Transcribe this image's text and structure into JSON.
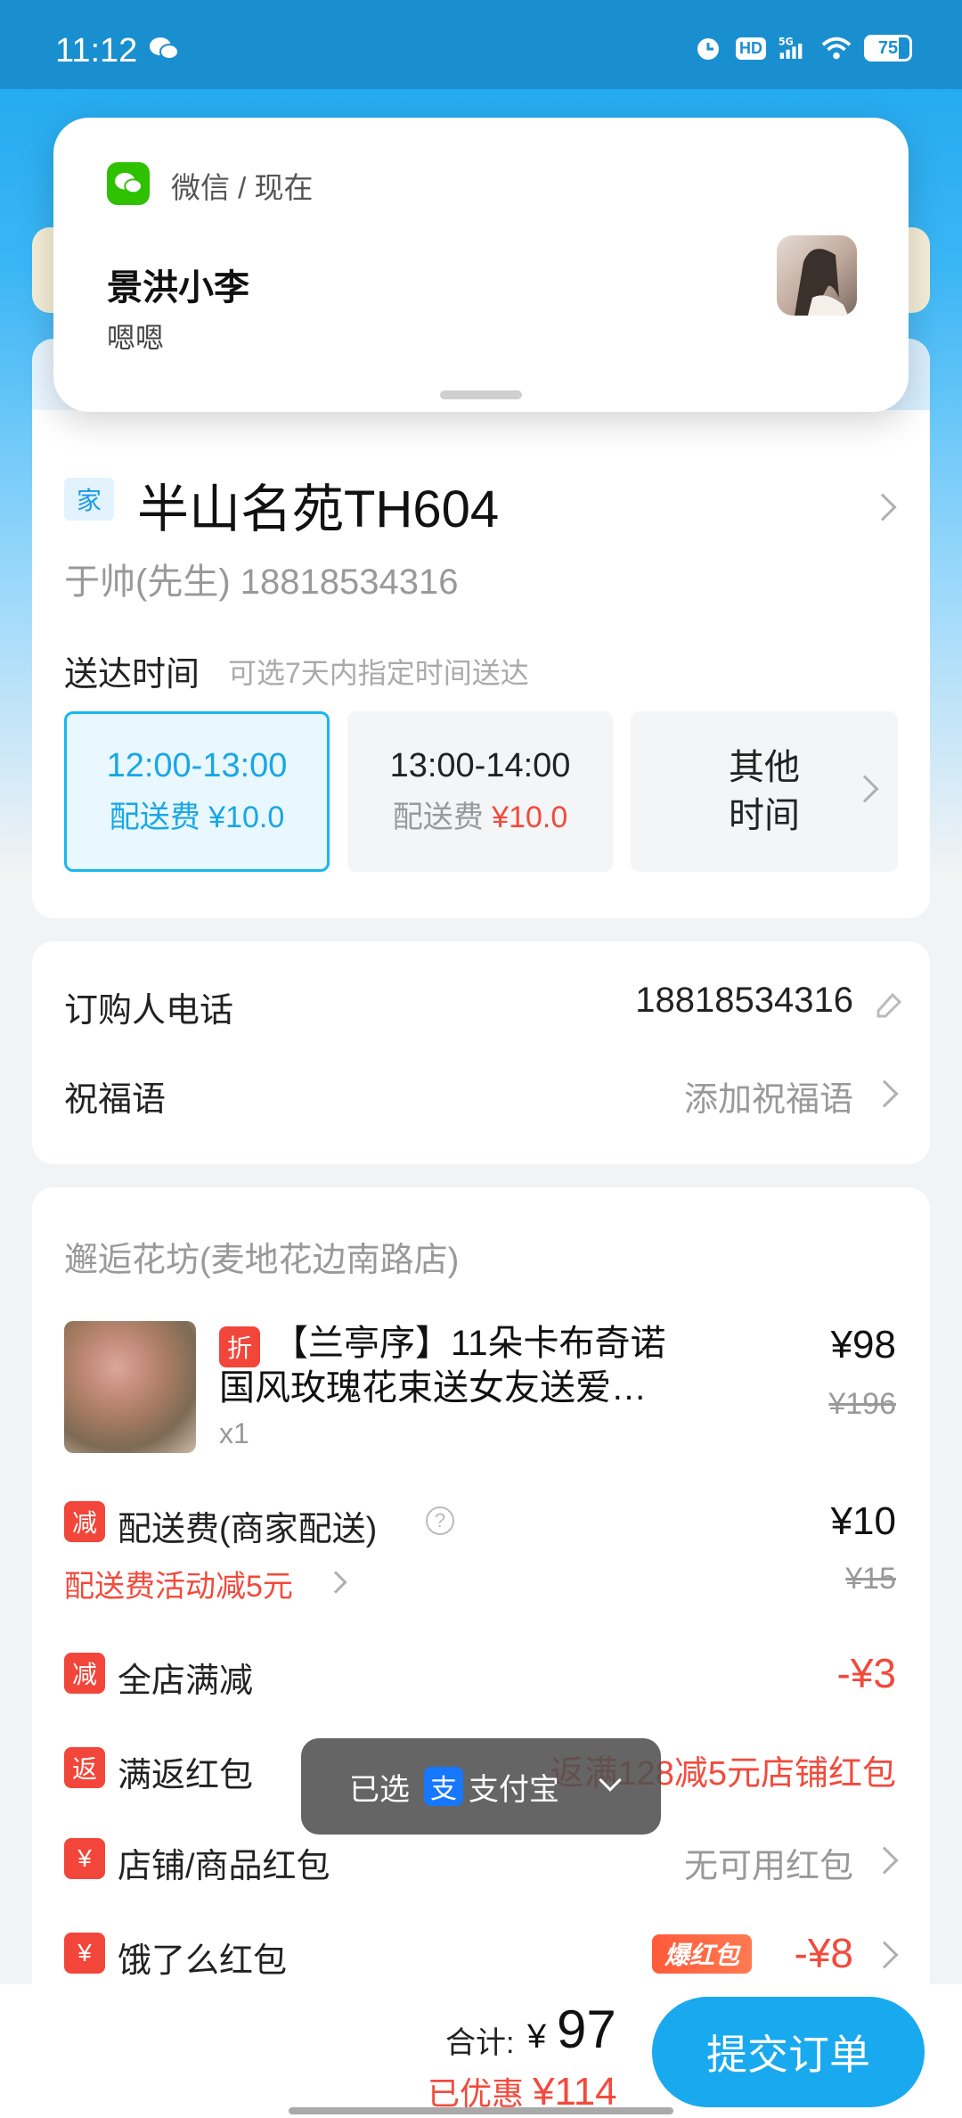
{
  "status_bar": {
    "time": "11:12",
    "hd_badge": "HD",
    "network": "5G",
    "battery": "75",
    "battery_level": 0.75
  },
  "notification": {
    "app": "微信 / 现在",
    "sender": "景洪小李",
    "message": "嗯嗯"
  },
  "address": {
    "tag": "家",
    "title": "半山名苑TH604",
    "contact": "于帅(先生) 18818534316"
  },
  "delivery": {
    "label": "送达时间",
    "hint": "可选7天内指定时间送达",
    "slots": [
      {
        "time": "12:00-13:00",
        "fee_label": "配送费",
        "fee": "¥10.0"
      },
      {
        "time": "13:00-14:00",
        "fee_label": "配送费",
        "fee": "¥10.0"
      }
    ],
    "other_line1": "其他",
    "other_line2": "时间"
  },
  "contact": {
    "phone_label": "订购人电话",
    "phone_value": "18818534316",
    "blessing_label": "祝福语",
    "blessing_value": "添加祝福语"
  },
  "order": {
    "shop": "邂逅花坊(麦地花边南路店)",
    "product": {
      "tag": "折",
      "title": "【兰亭序】11朵卡布奇诺国风玫瑰花束送女友送爱…",
      "qty": "x1",
      "price": "¥98",
      "orig_price": "¥196"
    },
    "delivery_fee": {
      "tag": "减",
      "label": "配送费(商家配送)",
      "help": "?",
      "promo": "配送费活动减5元",
      "price": "¥10",
      "orig_price": "¥15"
    },
    "full_discount": {
      "tag": "减",
      "label": "全店满减",
      "value": "-¥3"
    },
    "cashback": {
      "tag": "返",
      "label": "满返红包",
      "value": "返满128减5元店铺红包"
    },
    "shop_packet": {
      "tag": "¥",
      "label": "店铺/商品红包",
      "value": "无可用红包"
    },
    "ele_packet": {
      "tag": "¥",
      "label": "饿了么红包",
      "badge": "爆红包",
      "value": "-¥8"
    }
  },
  "toast": {
    "prefix": "已选",
    "alipay_icon": "支",
    "method": "支付宝"
  },
  "bottom": {
    "total_label": "合计:",
    "currency": "¥",
    "total": "97",
    "saved_label": "已优惠",
    "saved_amount": "¥114",
    "submit": "提交订单"
  },
  "colors": {
    "accent": "#19a9ef",
    "red": "#f24a3c",
    "status_bar": "#1a8fd0"
  }
}
